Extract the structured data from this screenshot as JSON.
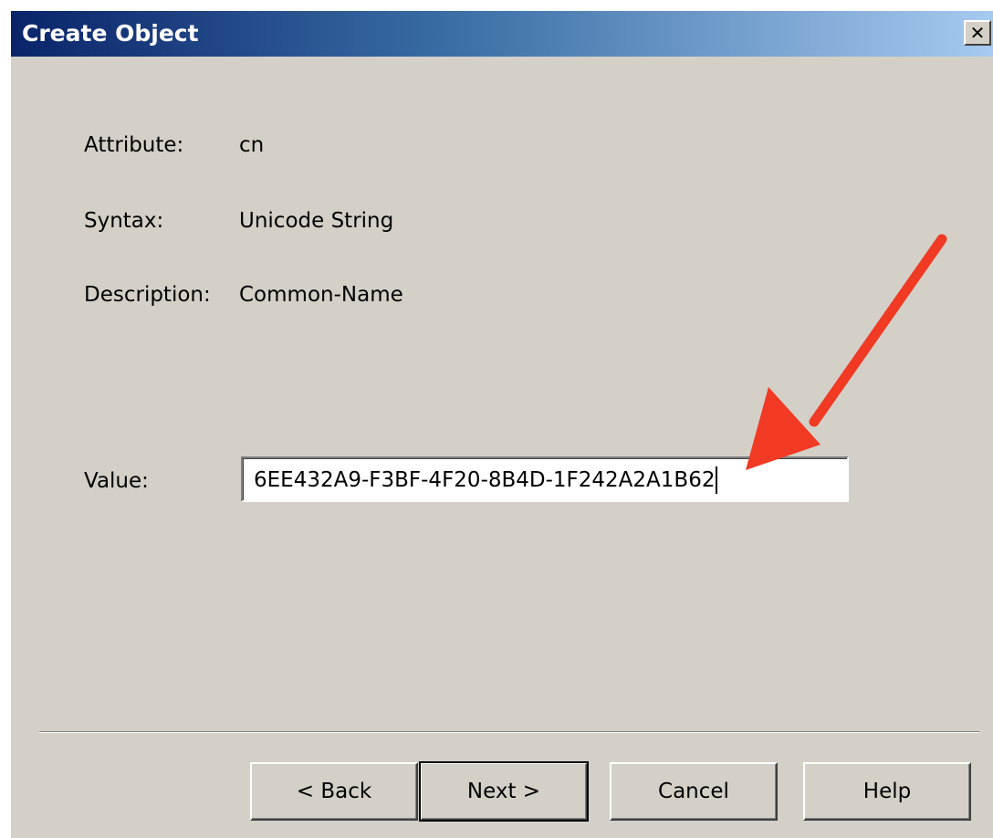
{
  "window": {
    "title": "Create Object",
    "close_glyph": "✕"
  },
  "fields": {
    "attribute": {
      "label": "Attribute:",
      "value": "cn"
    },
    "syntax": {
      "label": "Syntax:",
      "value": "Unicode String"
    },
    "description": {
      "label": "Description:",
      "value": "Common-Name"
    },
    "value": {
      "label": "Value:",
      "input_value": "6EE432A9-F3BF-4F20-8B4D-1F242A2A1B62"
    }
  },
  "buttons": {
    "back": "< Back",
    "next": "Next >",
    "cancel": "Cancel",
    "help": "Help"
  },
  "annotation": {
    "arrow_color": "#f03a24"
  },
  "colors": {
    "dialog_bg": "#d4d0c8",
    "title_gradient_start": "#0a246a",
    "title_gradient_end": "#a6caf0"
  }
}
